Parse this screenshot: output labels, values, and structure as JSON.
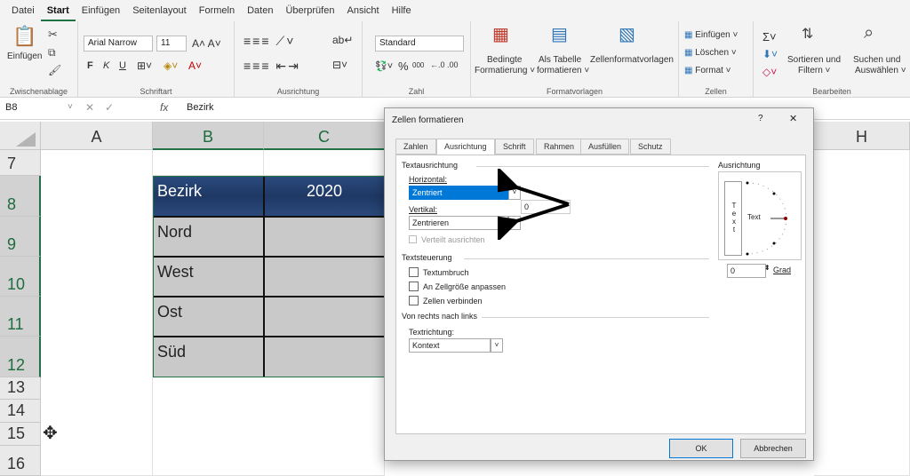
{
  "menu": [
    "Datei",
    "Start",
    "Einfügen",
    "Seitenlayout",
    "Formeln",
    "Daten",
    "Überprüfen",
    "Ansicht",
    "Hilfe"
  ],
  "ribbon": {
    "clipboard": {
      "paste": "Einfügen",
      "label": "Zwischenablage"
    },
    "font": {
      "name": "Arial Narrow",
      "size": "11",
      "bold": "F",
      "italic": "K",
      "underline": "U",
      "label": "Schriftart"
    },
    "alignment": {
      "label": "Ausrichtung"
    },
    "number": {
      "format": "Standard",
      "label": "Zahl",
      "percent": "%",
      "thousands": "000"
    },
    "styles": {
      "conditional": "Bedingte",
      "conditional2": "Formatierung ˅",
      "table": "Als Tabelle",
      "table2": "formatieren ˅",
      "cellstyles": "Zellenformatvorlagen",
      "label": "Formatvorlagen"
    },
    "cells": {
      "insert": "Einfügen ˅",
      "delete": "Löschen ˅",
      "format": "Format ˅",
      "label": "Zellen"
    },
    "editing": {
      "sort": "Sortieren und",
      "sort2": "Filtern ˅",
      "find": "Suchen und",
      "find2": "Auswählen ˅",
      "label": "Bearbeiten"
    }
  },
  "formula_bar": {
    "cell_ref": "B8",
    "fx": "fx",
    "value": "Bezirk"
  },
  "columns": [
    "A",
    "B",
    "C",
    "H"
  ],
  "rows": [
    "7",
    "8",
    "9",
    "10",
    "11",
    "12",
    "13",
    "14",
    "15",
    "16"
  ],
  "cells": {
    "b8": "Bezirk",
    "c8": "2020",
    "b9": "Nord",
    "b10": "West",
    "b11": "Ost",
    "b12": "Süd"
  },
  "dialog": {
    "title": "Zellen formatieren",
    "help": "?",
    "close": "✕",
    "tabs": [
      "Zahlen",
      "Ausrichtung",
      "Schrift",
      "Rahmen",
      "Ausfüllen",
      "Schutz"
    ],
    "text_alignment": "Textausrichtung",
    "horizontal_label": "Horizontal:",
    "horizontal_value": "Zentriert",
    "vertical_label": "Vertikal:",
    "vertical_value": "Zentrieren",
    "indent_value": "0",
    "distributed": "Verteilt ausrichten",
    "text_control": "Textsteuerung",
    "wrap": "Textumbruch",
    "shrink": "An Zellgröße anpassen",
    "merge": "Zellen verbinden",
    "rtl": "Von rechts nach links",
    "direction_label": "Textrichtung:",
    "direction_value": "Kontext",
    "orientation": "Ausrichtung",
    "vertical_text": [
      "T",
      "e",
      "x",
      "t"
    ],
    "orient_text": "Text",
    "degrees_value": "0",
    "degrees_label": "Grad",
    "ok": "OK",
    "cancel": "Abbrechen"
  },
  "colors": {
    "accent": "#217346",
    "header_fill": "#1f3864",
    "data_fill": "#c9c9c9",
    "highlight": "#0078d7"
  }
}
